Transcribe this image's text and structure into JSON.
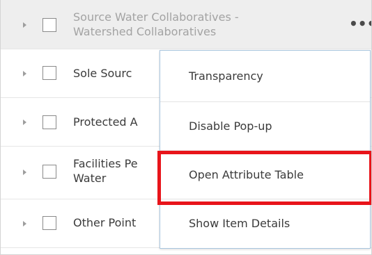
{
  "layers": [
    {
      "label_line1": "Source Water Collaboratives -",
      "label_line2": "Watershed Collaboratives"
    },
    {
      "label_line1": "Sole Sourc",
      "label_line2": ""
    },
    {
      "label_line1": "Protected A",
      "label_line2": ""
    },
    {
      "label_line1": "Facilities Pe",
      "label_line2": "Water"
    },
    {
      "label_line1": "Other Point",
      "label_line2": ""
    }
  ],
  "more_icon": "•••",
  "context_menu": {
    "items": [
      {
        "label": "Transparency"
      },
      {
        "label": "Disable Pop-up"
      },
      {
        "label": "Open Attribute Table"
      },
      {
        "label": "Show Item Details"
      }
    ]
  },
  "colors": {
    "highlight": "#e8141a",
    "menu_border": "#a8c5de",
    "selected_row_bg": "#eeeeee"
  }
}
